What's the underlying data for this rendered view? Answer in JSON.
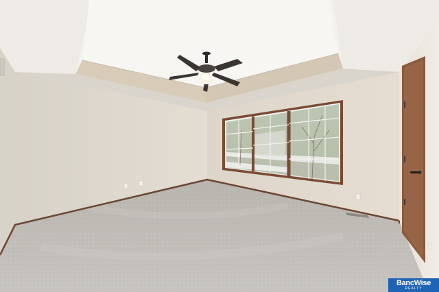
{
  "scene": {
    "description_free": true,
    "colors": {
      "wall": "#e0d8cd",
      "ceiling": "#f2efea",
      "carpet": "#bdbab6",
      "trim": "#6b4632",
      "door": "#8a5a3c",
      "window_frame": "#7a4b33"
    },
    "icons": [
      "ceiling-fan-icon",
      "door-handle-icon",
      "outlet-icon",
      "floor-vent-icon"
    ]
  },
  "watermark": {
    "brand": "BancWise",
    "sub": "REALTY",
    "color": "#1f63b5"
  }
}
